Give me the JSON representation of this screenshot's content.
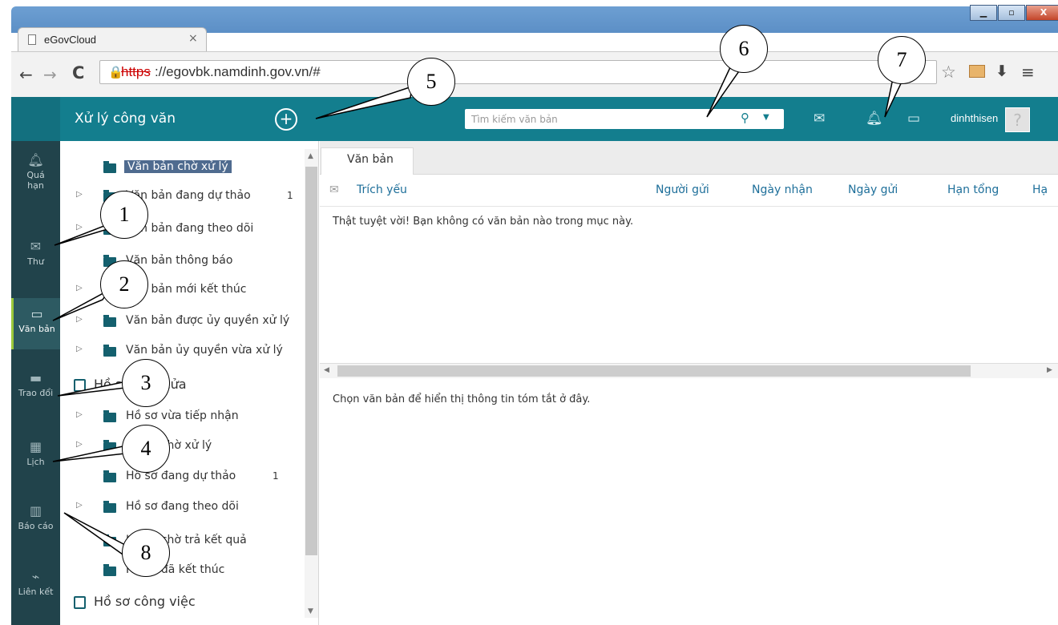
{
  "browser": {
    "tab_title": "eGovCloud",
    "tab_close": "×",
    "new_tab": "+",
    "url_scheme": "https",
    "url_rest": "://egovbk.namdinh.gov.vn/#",
    "back": "←",
    "forward": "→",
    "reload": "C",
    "star": "☆",
    "download": "⬇",
    "menu": "≡",
    "win_min": "▁",
    "win_max": "▫",
    "win_close": "X"
  },
  "header": {
    "title": "Xử lý công văn",
    "add": "+",
    "search_placeholder": "Tìm kiếm văn bản",
    "search_icon": "search-icon",
    "username": "dinhthisen"
  },
  "leftnav": [
    {
      "label": "Quá hạn",
      "icon": "bell-icon"
    },
    {
      "label": "Thư",
      "icon": "mail-icon"
    },
    {
      "label": "Văn bản",
      "icon": "folder-icon",
      "active": true
    },
    {
      "label": "Trao đổi",
      "icon": "chat-icon"
    },
    {
      "label": "Lịch",
      "icon": "calendar-icon"
    },
    {
      "label": "Báo cáo",
      "icon": "chart-icon"
    },
    {
      "label": "Liên kết",
      "icon": "link-icon"
    }
  ],
  "tree": {
    "items": [
      {
        "label": "Văn bản chờ xử lý",
        "selected": true,
        "arrow": false
      },
      {
        "label": "Văn bản đang dự thảo",
        "count": "1",
        "arrow": true
      },
      {
        "label": "Văn bản đang theo dõi",
        "arrow": true
      },
      {
        "label": "Văn bản thông báo",
        "arrow": false
      },
      {
        "label": "Văn bản mới kết thúc",
        "arrow": true
      },
      {
        "label": "Văn bản được ủy quyền xử lý",
        "arrow": true
      },
      {
        "label": "Văn bản ủy quyền vừa xử lý",
        "arrow": true
      },
      {
        "label": "Hồ sơ một cửa",
        "group": true
      },
      {
        "label": "Hồ sơ vừa tiếp nhận",
        "arrow": true
      },
      {
        "label": "Hồ sơ chờ xử lý",
        "arrow": true
      },
      {
        "label": "Hồ sơ đang dự thảo",
        "count": "1",
        "arrow": false
      },
      {
        "label": "Hồ sơ đang theo dõi",
        "arrow": true
      },
      {
        "label": "Hồ sơ chờ trả kết quả",
        "arrow": false
      },
      {
        "label": "Hồ sơ đã kết thúc",
        "arrow": false
      },
      {
        "label": "Hồ sơ công việc",
        "group": true
      }
    ]
  },
  "content": {
    "tab_label": "Văn bản",
    "columns": [
      "Trích yếu",
      "Người gửi",
      "Ngày nhận",
      "Ngày gửi",
      "Hạn tổng",
      "Hạ"
    ],
    "empty_message": "Thật tuyệt vời! Bạn không có văn bản nào trong mục này.",
    "summary_message": "Chọn văn bản để hiển thị thông tin tóm tắt ở đây."
  },
  "callouts": [
    "1",
    "2",
    "3",
    "4",
    "5",
    "6",
    "7",
    "8"
  ],
  "colors": {
    "header": "#137e8e",
    "leftnav": "#21434b",
    "folder": "#14606e",
    "selected": "#4f6b8f",
    "active_accent": "#9cc93b",
    "column_header": "#1e6f9a"
  }
}
